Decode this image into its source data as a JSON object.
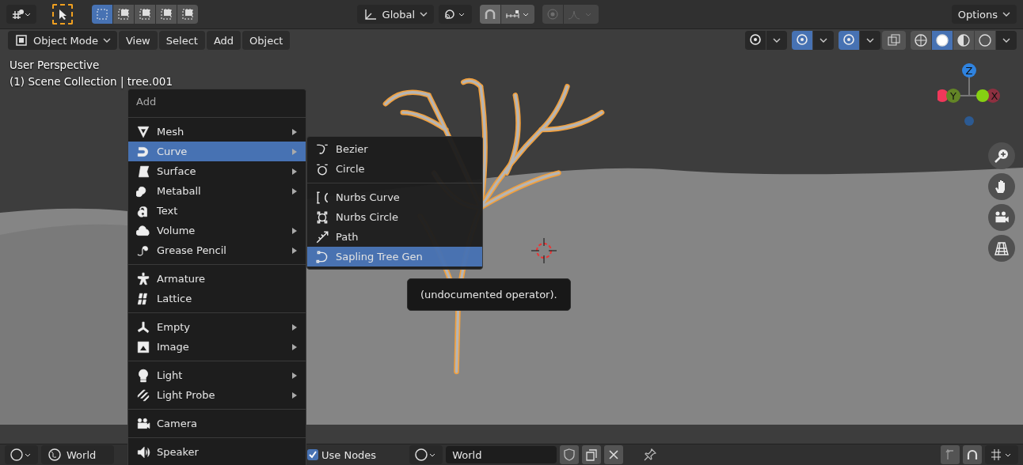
{
  "header": {
    "select_modes": [
      {
        "selected": true
      },
      {
        "selected": false
      },
      {
        "selected": false
      },
      {
        "selected": false
      },
      {
        "selected": false
      }
    ],
    "orientation": "Global",
    "snap_on": true,
    "options": "Options"
  },
  "toolbar": {
    "mode": "Object Mode",
    "menus": [
      "View",
      "Select",
      "Add",
      "Object"
    ],
    "overlay_toggles": [
      {
        "selected": false
      },
      {
        "selected": true
      },
      {
        "selected": true
      }
    ],
    "shading": [
      {
        "selected": false
      },
      {
        "selected": true
      },
      {
        "selected": false
      },
      {
        "selected": false
      }
    ]
  },
  "viewport": {
    "title": "User Perspective",
    "subtitle": "(1) Scene Collection | tree.001",
    "axes": [
      "Z",
      "Y",
      "X"
    ]
  },
  "add_menu": {
    "title": "Add",
    "groups": [
      [
        {
          "label": "Mesh",
          "submenu": true,
          "selected": false
        },
        {
          "label": "Curve",
          "submenu": true,
          "selected": true
        },
        {
          "label": "Surface",
          "submenu": true,
          "selected": false
        },
        {
          "label": "Metaball",
          "submenu": true,
          "selected": false
        },
        {
          "label": "Text",
          "submenu": false,
          "selected": false
        },
        {
          "label": "Volume",
          "submenu": true,
          "selected": false
        },
        {
          "label": "Grease Pencil",
          "submenu": true,
          "selected": false
        }
      ],
      [
        {
          "label": "Armature",
          "submenu": false,
          "selected": false
        },
        {
          "label": "Lattice",
          "submenu": false,
          "selected": false
        }
      ],
      [
        {
          "label": "Empty",
          "submenu": true,
          "selected": false
        },
        {
          "label": "Image",
          "submenu": true,
          "selected": false
        }
      ],
      [
        {
          "label": "Light",
          "submenu": true,
          "selected": false
        },
        {
          "label": "Light Probe",
          "submenu": true,
          "selected": false
        }
      ],
      [
        {
          "label": "Camera",
          "submenu": false,
          "selected": false
        }
      ],
      [
        {
          "label": "Speaker",
          "submenu": false,
          "selected": false
        }
      ]
    ]
  },
  "curve_menu": {
    "groups": [
      [
        {
          "label": "Bezier",
          "selected": false
        },
        {
          "label": "Circle",
          "selected": false
        }
      ],
      [
        {
          "label": "Nurbs Curve",
          "selected": false
        },
        {
          "label": "Nurbs Circle",
          "selected": false
        },
        {
          "label": "Path",
          "selected": false
        },
        {
          "label": "Sapling Tree Gen",
          "selected": true
        }
      ]
    ]
  },
  "tooltip": "(undocumented operator).",
  "bottom_bar": {
    "world": "World",
    "use_nodes": {
      "label": "Use Nodes",
      "checked": true
    },
    "world_field": "World"
  }
}
